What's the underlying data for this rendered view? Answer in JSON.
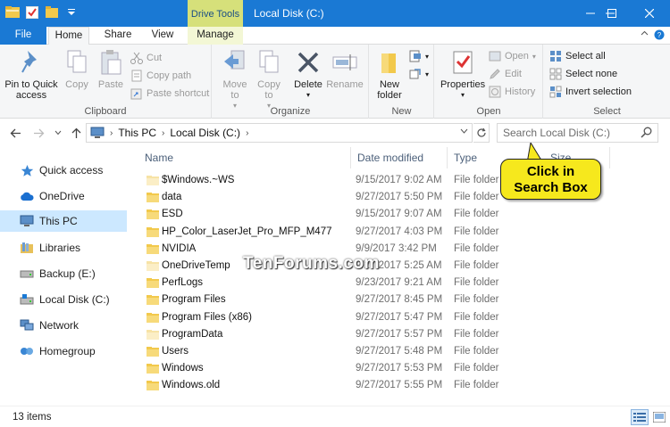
{
  "window": {
    "title": "Local Disk (C:)",
    "contextual_tab": "Drive Tools",
    "controls": [
      "minimize",
      "maximize",
      "close"
    ]
  },
  "ribbon_tabs": [
    "File",
    "Home",
    "Share",
    "View",
    "Manage"
  ],
  "ribbon": {
    "clipboard": {
      "label": "Clipboard",
      "pin": "Pin to Quick access",
      "copy": "Copy",
      "paste": "Paste",
      "cut": "Cut",
      "copy_path": "Copy path",
      "paste_shortcut": "Paste shortcut"
    },
    "organize": {
      "label": "Organize",
      "move_to": "Move to",
      "copy_to": "Copy to",
      "delete": "Delete",
      "rename": "Rename"
    },
    "new": {
      "label": "New",
      "new_folder": "New folder"
    },
    "open": {
      "label": "Open",
      "properties": "Properties",
      "open": "Open",
      "edit": "Edit",
      "history": "History"
    },
    "select": {
      "label": "Select",
      "select_all": "Select all",
      "select_none": "Select none",
      "invert": "Invert selection"
    }
  },
  "address": {
    "crumbs": [
      "This PC",
      "Local Disk (C:)"
    ],
    "search_placeholder": "Search Local Disk (C:)"
  },
  "nav": [
    {
      "label": "Quick access",
      "icon": "star-icon"
    },
    {
      "label": "OneDrive",
      "icon": "cloud-icon"
    },
    {
      "label": "This PC",
      "icon": "computer-icon",
      "selected": true
    },
    {
      "label": "Libraries",
      "icon": "library-icon"
    },
    {
      "label": "Backup (E:)",
      "icon": "drive-icon"
    },
    {
      "label": "Local Disk (C:)",
      "icon": "drive-icon"
    },
    {
      "label": "Network",
      "icon": "network-icon"
    },
    {
      "label": "Homegroup",
      "icon": "homegroup-icon"
    }
  ],
  "columns": {
    "name": "Name",
    "date": "Date modified",
    "type": "Type",
    "size": "Size"
  },
  "files": [
    {
      "name": "$Windows.~WS",
      "date": "9/15/2017 9:02 AM",
      "type": "File folder",
      "faded": true
    },
    {
      "name": "data",
      "date": "9/27/2017 5:50 PM",
      "type": "File folder"
    },
    {
      "name": "ESD",
      "date": "9/15/2017 9:07 AM",
      "type": "File folder"
    },
    {
      "name": "HP_Color_LaserJet_Pro_MFP_M477",
      "date": "9/27/2017 4:03 PM",
      "type": "File folder"
    },
    {
      "name": "NVIDIA",
      "date": "9/9/2017 3:42 PM",
      "type": "File folder"
    },
    {
      "name": "OneDriveTemp",
      "date": "9/27/2017 5:25 AM",
      "type": "File folder",
      "faded": true
    },
    {
      "name": "PerfLogs",
      "date": "9/23/2017 9:21 AM",
      "type": "File folder"
    },
    {
      "name": "Program Files",
      "date": "9/27/2017 8:45 PM",
      "type": "File folder"
    },
    {
      "name": "Program Files (x86)",
      "date": "9/27/2017 5:47 PM",
      "type": "File folder"
    },
    {
      "name": "ProgramData",
      "date": "9/27/2017 5:57 PM",
      "type": "File folder",
      "faded": true
    },
    {
      "name": "Users",
      "date": "9/27/2017 5:48 PM",
      "type": "File folder"
    },
    {
      "name": "Windows",
      "date": "9/27/2017 5:53 PM",
      "type": "File folder"
    },
    {
      "name": "Windows.old",
      "date": "9/27/2017 5:55 PM",
      "type": "File folder"
    }
  ],
  "callout": {
    "line1": "Click in",
    "line2": "Search Box"
  },
  "watermark": "TenForums.com",
  "status": {
    "items": "13 items"
  },
  "colors": {
    "titlebar": "#1a79d4",
    "folder": "#f2c94c",
    "callout": "#f6e81d",
    "selection": "#cce8ff"
  }
}
